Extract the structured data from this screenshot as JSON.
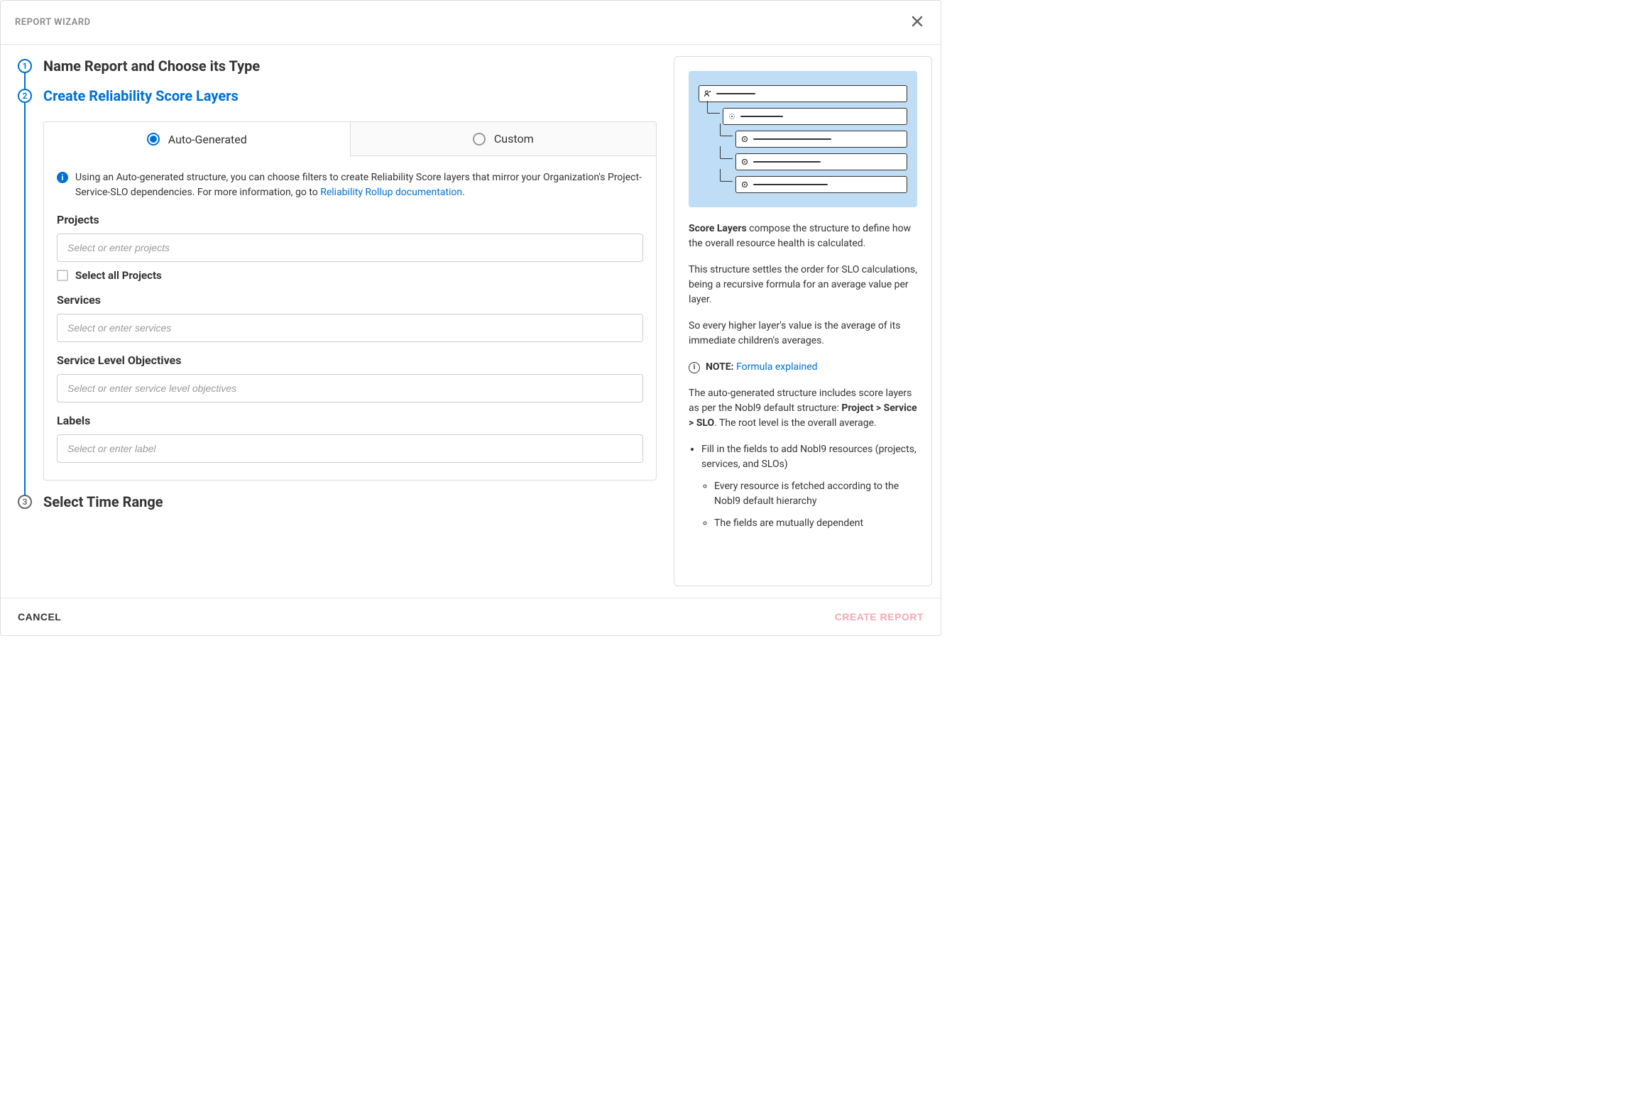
{
  "header": {
    "title": "REPORT WIZARD"
  },
  "steps": [
    {
      "num": "1",
      "title": "Name Report and Choose its Type",
      "state": "done"
    },
    {
      "num": "2",
      "title": "Create Reliability Score Layers",
      "state": "active"
    },
    {
      "num": "3",
      "title": "Select Time Range",
      "state": "pending"
    }
  ],
  "tabs": {
    "auto": "Auto-Generated",
    "custom": "Custom"
  },
  "info": {
    "text_before": "Using an Auto-generated structure, you can choose filters to create Reliability Score layers that mirror your Organization's Project-Service-SLO dependencies. For more information, go to ",
    "link": "Reliability Rollup documentation",
    "text_after": "."
  },
  "form": {
    "projects_label": "Projects",
    "projects_placeholder": "Select or enter projects",
    "select_all_projects": "Select all Projects",
    "services_label": "Services",
    "services_placeholder": "Select or enter services",
    "slo_label": "Service Level Objectives",
    "slo_placeholder": "Select or enter service level objectives",
    "labels_label": "Labels",
    "labels_placeholder": "Select or enter label"
  },
  "side": {
    "p1_strong": "Score Layers",
    "p1_rest": " compose the structure to define how the overall resource health is calculated.",
    "p2": "This structure settles the order for SLO calculations, being a recursive formula for an average value per layer.",
    "p3": "So every higher layer's value is the average of its immediate children's averages.",
    "note_label": "NOTE:",
    "note_link": "Formula explained",
    "p4_before": "The auto-generated structure includes score layers as per the Nobl9 default structure: ",
    "p4_strong": "Project > Service > SLO",
    "p4_after": ". The root level is the overall average.",
    "li1": "Fill in the fields to add Nobl9 resources (projects, services, and SLOs)",
    "li1a": "Every resource is fetched according to the Nobl9 default hierarchy",
    "li1b": "The fields are mutually dependent"
  },
  "footer": {
    "cancel": "CANCEL",
    "create": "CREATE REPORT"
  }
}
